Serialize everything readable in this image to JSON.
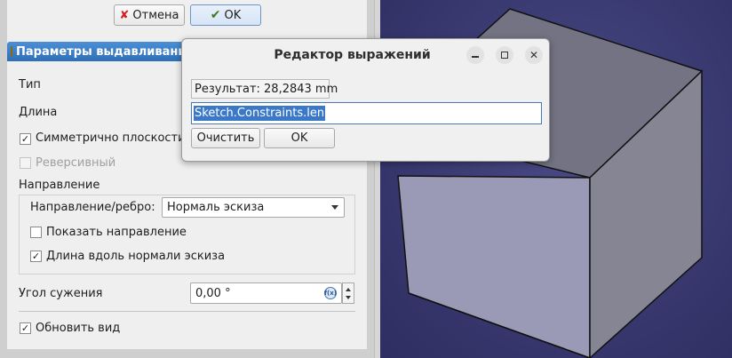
{
  "panel": {
    "cancel_label": "Отмена",
    "ok_label": "OK",
    "header_title": "Параметры выдавливания",
    "type_label": "Тип",
    "length_label": "Длина",
    "symmetric_label": "Симметрично плоскости",
    "symmetric_checked": true,
    "reversed_label": "Реверсивный",
    "reversed_checked": false,
    "direction_heading": "Направление",
    "direction_edge_label": "Направление/ребро:",
    "direction_value": "Нормаль эскиза",
    "show_direction_label": "Показать направление",
    "show_direction_checked": false,
    "along_normal_label": "Длина вдоль нормали эскиза",
    "along_normal_checked": true,
    "taper_label": "Угол сужения",
    "taper_value": "0,00 °",
    "update_view_label": "Обновить вид",
    "update_view_checked": true
  },
  "dialog": {
    "title": "Редактор выражений",
    "result_text": "Результат: 28,2843 mm",
    "expression": "Sketch.Constraints.len",
    "clear_label": "Очистить",
    "ok_label": "OK"
  },
  "icons": {
    "check_glyph": "✓",
    "fx_glyph": "f(x)"
  },
  "colors": {
    "view_bg": "#35356b",
    "cube_front": "#9a9ab6",
    "cube_right": "#858594",
    "cube_top": "#737383",
    "selection": "#3c78c8"
  }
}
